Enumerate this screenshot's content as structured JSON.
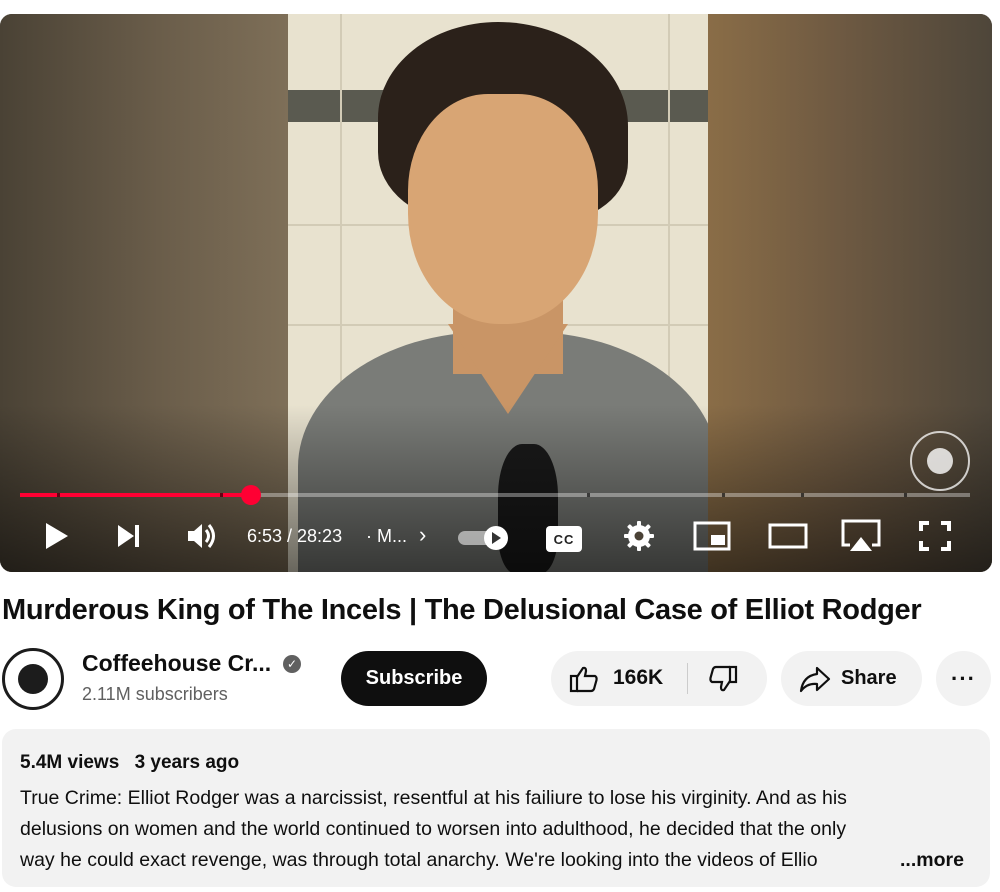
{
  "player": {
    "time_display": "6:53 / 28:23",
    "chapter_label": "· M...",
    "progress": 0.243,
    "chapter_fractions": [
      0.039,
      0.211,
      0.597,
      0.739,
      0.822,
      0.93
    ],
    "buttons": [
      "play-icon",
      "next-icon",
      "volume-icon",
      "autoplay-toggle",
      "cc-icon",
      "settings-icon",
      "miniplayer-icon",
      "theater-icon",
      "airplay-icon",
      "fullscreen-icon"
    ],
    "cc_label": "CC",
    "accent_color": "#ff0033"
  },
  "video": {
    "title": "Murderous King of The Incels | The Delusional Case of Elliot Rodger"
  },
  "channel": {
    "name": "Coffeehouse Cr...",
    "subscribers": "2.11M subscribers",
    "verified": true
  },
  "actions": {
    "subscribe_label": "Subscribe",
    "like_count": "166K",
    "share_label": "Share",
    "more_label": "···"
  },
  "description": {
    "views": "5.4M views",
    "age": "3 years ago",
    "line1": "True Crime: Elliot Rodger was a narcissist, resentful at his failiure to lose his virginity. And as his",
    "line2": "delusions on women and the world continued to worsen into adulthood, he decided that the only",
    "line3": "way he could exact revenge, was through total anarchy. We're looking into the videos of Ellio",
    "more_label": "...more"
  }
}
